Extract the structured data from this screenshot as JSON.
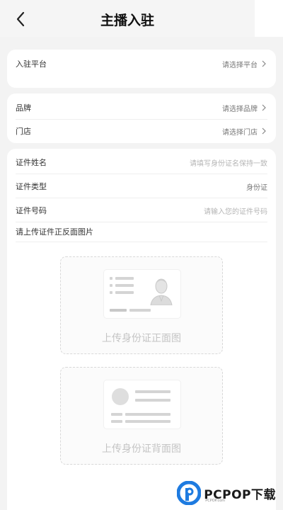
{
  "header": {
    "title": "主播入驻"
  },
  "platform": {
    "label": "入驻平台",
    "value": "请选择平台"
  },
  "brand": {
    "label": "品牌",
    "value": "请选择品牌"
  },
  "store": {
    "label": "门店",
    "value": "请选择门店"
  },
  "id_form": {
    "name_label": "证件姓名",
    "name_placeholder": "请填写身份证名保持一致",
    "type_label": "证件类型",
    "type_value": "身份证",
    "number_label": "证件号码",
    "number_placeholder": "请输入您的证件号码",
    "upload_prompt": "请上传证件正反面图片"
  },
  "uploads": {
    "front_label": "上传身份证正面图",
    "back_label": "上传身份证背面图"
  },
  "watermark": {
    "brand": "PCPOP下载",
    "sub": "PCPOP.com"
  }
}
